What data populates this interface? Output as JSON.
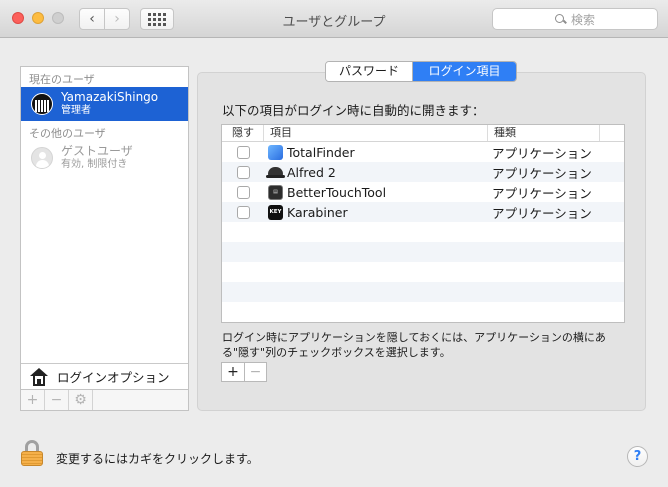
{
  "window": {
    "title": "ユーザとグループ",
    "search_placeholder": "検索",
    "back_label": "‹",
    "forward_label": "›"
  },
  "sidebar": {
    "current_section": "現在のユーザ",
    "current_user": {
      "name": "YamazakiShingo",
      "role": "管理者"
    },
    "other_section": "その他のユーザ",
    "guest_user": {
      "name": "ゲストユーザ",
      "status": "有効, 制限付き"
    },
    "login_options": "ログインオプション",
    "add_label": "+",
    "remove_label": "−",
    "settings_icon": "gear-icon"
  },
  "tabs": [
    {
      "label": "パスワード",
      "selected": false
    },
    {
      "label": "ログイン項目",
      "selected": true
    }
  ],
  "main": {
    "caption": "以下の項目がログイン時に自動的に開きます：",
    "columns": {
      "hide": "隠す",
      "item": "項目",
      "kind": "種類"
    },
    "rows": [
      {
        "name": "TotalFinder",
        "kind": "アプリケーション",
        "icon": "totalfinder-icon",
        "hidden": false
      },
      {
        "name": "Alfred 2",
        "kind": "アプリケーション",
        "icon": "alfred-icon",
        "hidden": false
      },
      {
        "name": "BetterTouchTool",
        "kind": "アプリケーション",
        "icon": "bettertouchtool-icon",
        "hidden": false
      },
      {
        "name": "Karabiner",
        "kind": "アプリケーション",
        "icon": "karabiner-icon",
        "hidden": false
      }
    ],
    "help_text_line1": "ログイン時にアプリケーションを隠しておくには、アプリケーションの横にあ",
    "help_text_line2": "る\"隠す\"列のチェックボックスを選択します。",
    "add_label": "+",
    "remove_label": "−"
  },
  "footer": {
    "lock_text": "変更するにはカギをクリックします。",
    "help_label": "?"
  },
  "colors": {
    "selection_blue": "#1d62d4",
    "segment_blue": "#2f7ff5",
    "lock_orange": "#f5b04a"
  }
}
